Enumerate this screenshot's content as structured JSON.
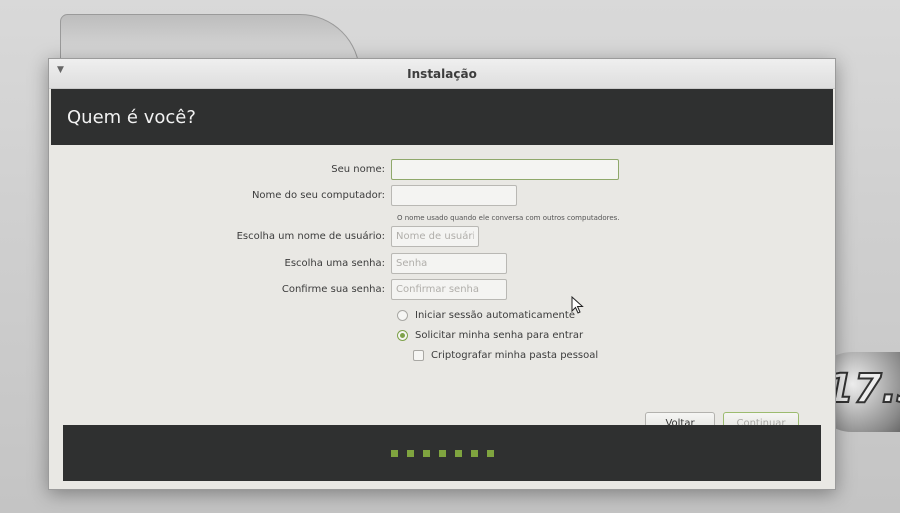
{
  "window": {
    "title": "Instalação",
    "header_title": "Quem é você?"
  },
  "form": {
    "name_label": "Seu nome:",
    "name_value": "",
    "computer_label": "Nome do seu computador:",
    "computer_value": "",
    "computer_hint": "O nome usado quando ele conversa com outros computadores.",
    "username_label": "Escolha um nome de usuário:",
    "username_placeholder": "Nome de usuário",
    "password_label": "Escolha uma senha:",
    "password_placeholder": "Senha",
    "confirm_label": "Confirme sua senha:",
    "confirm_placeholder": "Confirmar senha",
    "auto_login_label": "Iniciar sessão automaticamente",
    "require_password_label": "Solicitar minha senha para entrar",
    "encrypt_home_label": "Criptografar minha pasta pessoal",
    "login_mode_selected": "require_password",
    "encrypt_home_checked": false
  },
  "buttons": {
    "back": "Voltar",
    "continue": "Continuar"
  },
  "progress": {
    "steps": 7
  },
  "colors": {
    "accent": "#7fa43f",
    "header_bg": "#2f3030"
  }
}
